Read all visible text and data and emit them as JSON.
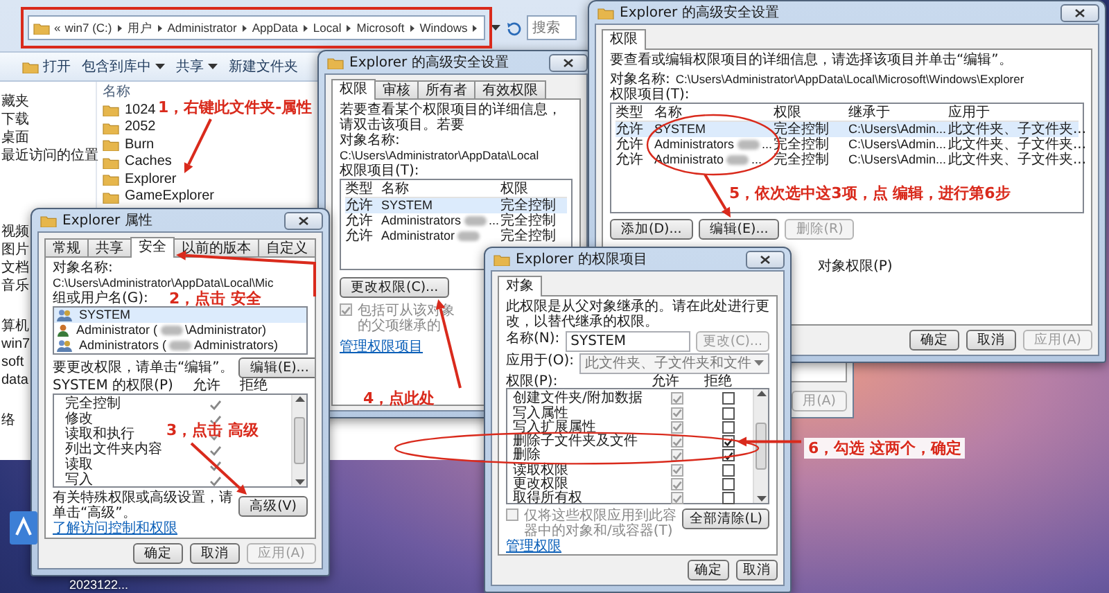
{
  "explorer": {
    "overflow_mark": "«",
    "address_path": [
      "win7 (C:)",
      "用户",
      "Administrator",
      "AppData",
      "Local",
      "Microsoft",
      "Windows"
    ],
    "search_placeholder": "搜索",
    "toolbar": [
      {
        "label": "打开",
        "icon": true,
        "dropdown": false
      },
      {
        "label": "包含到库中",
        "icon": false,
        "dropdown": true
      },
      {
        "label": "共享",
        "icon": false,
        "dropdown": true
      },
      {
        "label": "新建文件夹",
        "icon": false,
        "dropdown": false
      }
    ],
    "nav_groups": [
      [
        "藏夹",
        "下载",
        "桌面",
        "最近访问的位置"
      ],
      [
        "视频",
        "图片",
        "文档",
        "音乐"
      ],
      [
        "算机",
        "win7",
        "soft",
        "data"
      ],
      [
        "络"
      ]
    ],
    "column_header": "名称",
    "files": [
      "1024",
      "2052",
      "Burn",
      "Caches",
      "Explorer",
      "GameExplorer"
    ]
  },
  "advanced_back": {
    "title": "Explorer 的高级安全设置",
    "tabs": [
      {
        "label": "权限",
        "selected": true
      },
      {
        "label": "审核",
        "selected": false
      },
      {
        "label": "所有者",
        "selected": false
      },
      {
        "label": "有效权限",
        "selected": false
      }
    ],
    "hint": "若要查看某个权限项目的详细信息，请双击该项目。若要",
    "object_label": "对象名称:",
    "object_path": "C:\\Users\\Administrator\\AppData\\Local",
    "entries_label": "权限项目(T):",
    "columns": [
      "类型",
      "名称",
      "权限"
    ],
    "rows": [
      {
        "type": "允许",
        "name": "SYSTEM",
        "blurred": false,
        "permission": "完全控制",
        "selected": true
      },
      {
        "type": "允许",
        "name": "Administrators",
        "blurred": true,
        "suffix": "...",
        "permission": "完全控制",
        "selected": false
      },
      {
        "type": "允许",
        "name": "Administrator",
        "blurred": true,
        "permission": "完全控制",
        "selected": false
      }
    ],
    "change_button": "更改权限(C)...",
    "inherit": {
      "label": "包括可从该对象的父项继承的",
      "checked": true,
      "disabled": true
    },
    "manage_link": "管理权限项目"
  },
  "background_window": {
    "button": "用(A)"
  },
  "advanced_front": {
    "title": "Explorer 的高级安全设置",
    "tabs": [
      {
        "label": "权限",
        "selected": true
      }
    ],
    "hint": "要查看或编辑权限项目的详细信息，请选择该项目并单击“编辑”。",
    "object_label": "对象名称:",
    "object_path": "C:\\Users\\Administrator\\AppData\\Local\\Microsoft\\Windows\\Explorer",
    "entries_label": "权限项目(T):",
    "columns": [
      "类型",
      "名称",
      "权限",
      "继承于",
      "应用于"
    ],
    "rows": [
      {
        "type": "允许",
        "name": "SYSTEM",
        "blurred": false,
        "permission": "完全控制",
        "inherited_from": "C:\\Users\\Admin...",
        "applies_to": "此文件夹、子文件夹...",
        "selected": true
      },
      {
        "type": "允许",
        "name": "Administrators",
        "blurred": true,
        "suffix": "...",
        "permission": "完全控制",
        "inherited_from": "C:\\Users\\Admin...",
        "applies_to": "此文件夹、子文件夹...",
        "selected": false
      },
      {
        "type": "允许",
        "name": "Administrato",
        "blurred": true,
        "suffix": "...",
        "permission": "完全控制",
        "inherited_from": "C:\\Users\\Admin...",
        "applies_to": "此文件夹、子文件夹...",
        "selected": false
      }
    ],
    "buttons": [
      {
        "label": "添加(D)...",
        "disabled": false
      },
      {
        "label": "编辑(E)...",
        "disabled": false
      },
      {
        "label": "删除(R)",
        "disabled": true
      }
    ],
    "object_permissions_label": "对象权限(P)",
    "footer": [
      {
        "label": "确定",
        "disabled": false
      },
      {
        "label": "取消",
        "disabled": false
      },
      {
        "label": "应用(A)",
        "disabled": true
      }
    ]
  },
  "properties": {
    "title": "Explorer 属性",
    "tabs": [
      {
        "label": "常规",
        "selected": false
      },
      {
        "label": "共享",
        "selected": false
      },
      {
        "label": "安全",
        "selected": true
      },
      {
        "label": "以前的版本",
        "selected": false
      },
      {
        "label": "自定义",
        "selected": false
      }
    ],
    "object_label": "对象名称:",
    "object_path": "C:\\Users\\Administrator\\AppData\\Local\\Mic",
    "group_label": "组或用户名(G):",
    "users": [
      {
        "kind": "group",
        "name": "SYSTEM",
        "blurred": false,
        "selected": true
      },
      {
        "kind": "user",
        "name": "Administrator (",
        "blurred": true,
        "suffix": "\\Administrator)",
        "selected": false
      },
      {
        "kind": "group",
        "name": "Administrators (",
        "blurred": true,
        "suffix": "Administrators)",
        "selected": false
      }
    ],
    "edit_hint": "要更改权限，请单击“编辑”。",
    "edit_button": "编辑(E)...",
    "perm_label": "SYSTEM 的权限(P)",
    "allow_label": "允许",
    "deny_label": "拒绝",
    "permissions": [
      {
        "name": "完全控制",
        "allow": true,
        "deny": false
      },
      {
        "name": "修改",
        "allow": true,
        "deny": false
      },
      {
        "name": "读取和执行",
        "allow": true,
        "deny": false
      },
      {
        "name": "列出文件夹内容",
        "allow": true,
        "deny": false
      },
      {
        "name": "读取",
        "allow": true,
        "deny": false
      },
      {
        "name": "写入",
        "allow": true,
        "deny": false
      }
    ],
    "advanced_hint": "有关特殊权限或高级设置，请单击“高级”。",
    "advanced_button": "高级(V)",
    "learn_link": "了解访问控制和权限",
    "footer": [
      {
        "label": "确定",
        "disabled": false
      },
      {
        "label": "取消",
        "disabled": false
      },
      {
        "label": "应用(A)",
        "disabled": true
      }
    ]
  },
  "permission_entry": {
    "title": "Explorer 的权限项目",
    "tabs": [
      {
        "label": "对象",
        "selected": true
      }
    ],
    "note": "此权限是从父对象继承的。请在此处进行更改，以替代继承的权限。",
    "name_label": "名称(N):",
    "name_value": "SYSTEM",
    "change_button": {
      "label": "更改(C)...",
      "disabled": true
    },
    "apply_label": "应用于(O):",
    "apply_value": "此文件夹、子文件夹和文件",
    "perm_label": "权限(P):",
    "allow_label": "允许",
    "deny_label": "拒绝",
    "allow_disabled": true,
    "permissions": [
      {
        "name": "创建文件夹/附加数据",
        "allow": true,
        "deny": false
      },
      {
        "name": "写入属性",
        "allow": true,
        "deny": false
      },
      {
        "name": "写入扩展属性",
        "allow": true,
        "deny": false
      },
      {
        "name": "删除子文件夹及文件",
        "allow": true,
        "deny": true
      },
      {
        "name": "删除",
        "allow": true,
        "deny": true
      },
      {
        "name": "读取权限",
        "allow": true,
        "deny": false
      },
      {
        "name": "更改权限",
        "allow": true,
        "deny": false
      },
      {
        "name": "取得所有权",
        "allow": true,
        "deny": false
      }
    ],
    "only_apply": {
      "label": "仅将这些权限应用到此容器中的对象和/或容器(T)",
      "checked": false,
      "disabled": true
    },
    "clear_button": "全部清除(L)",
    "manage_link": "管理权限",
    "footer": [
      {
        "label": "确定",
        "disabled": false
      },
      {
        "label": "取消",
        "disabled": false
      }
    ]
  },
  "desktop": {
    "icon_label": "2023122..."
  },
  "annotations": [
    {
      "text": "1，右键此文件夹-属性"
    },
    {
      "text": "2，点击 安全"
    },
    {
      "text": "3，点击 高级"
    },
    {
      "text": "4，点此处"
    },
    {
      "text": "5，依次选中这3项，点 编辑，进行第6步"
    },
    {
      "text": "6，勾选 这两个，确定"
    }
  ]
}
